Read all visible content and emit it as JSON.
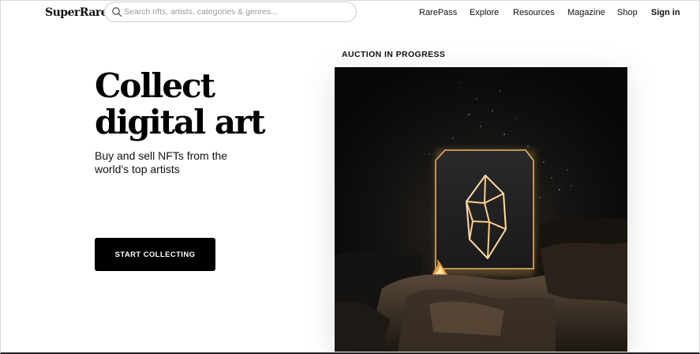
{
  "header": {
    "logo": "SuperRare",
    "search": {
      "placeholder": "Search nfts, artists, categories & genres..."
    },
    "nav": [
      "RarePass",
      "Explore",
      "Resources",
      "Magazine",
      "Shop"
    ],
    "sign_in": "Sign in"
  },
  "hero": {
    "headline_line1": "Collect",
    "headline_line2": "digital art",
    "subtitle": "Buy and sell NFTs from the world's top artists",
    "cta": "START COLLECTING"
  },
  "feature": {
    "label": "AUCTION IN PROGRESS",
    "artwork_icon": "glowing-crystal-frame-artwork",
    "colors": {
      "glow": "#f4b860",
      "background": "#0b0a09"
    }
  }
}
